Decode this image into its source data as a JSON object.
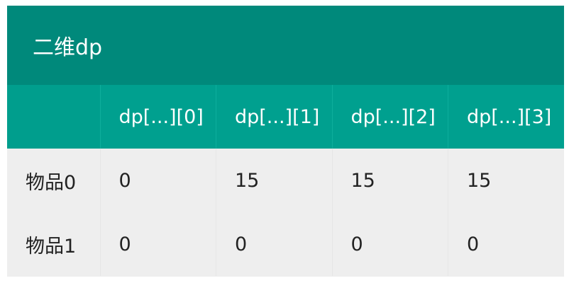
{
  "table": {
    "title": "二维dp",
    "columns": [
      "",
      "dp[...][0]",
      "dp[...][1]",
      "dp[...][2]",
      "dp[...][3]"
    ],
    "rows": [
      [
        "物品0",
        "0",
        "15",
        "15",
        "15"
      ],
      [
        "物品1",
        "0",
        "0",
        "0",
        "0"
      ]
    ]
  },
  "colors": {
    "title_bg": "#00897b",
    "header_bg": "#00a08f",
    "body_bg": "#eeeeee"
  }
}
